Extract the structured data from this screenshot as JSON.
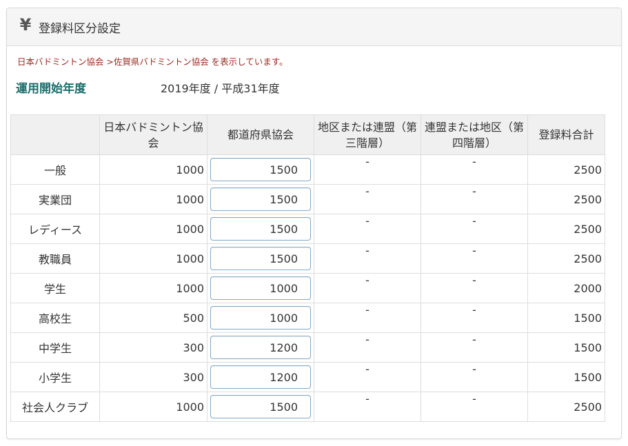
{
  "panel": {
    "icon": "yen-icon",
    "title": "登録料区分設定"
  },
  "notice": "日本バドミントン協会 >佐賀県バドミントン協会 を表示しています。",
  "year": {
    "label": "運用開始年度",
    "value": "2019年度 / 平成31年度"
  },
  "table": {
    "headers": {
      "category": "",
      "national": "日本バドミントン協会",
      "prefecture": "都道府県協会",
      "district": "地区または連盟（第三階層）",
      "league": "連盟または地区（第四階層）",
      "total": "登録料合計"
    },
    "rows": [
      {
        "category": "一般",
        "national": "1000",
        "prefecture": "1500",
        "district": "-",
        "league": "-",
        "total": "2500"
      },
      {
        "category": "実業団",
        "national": "1000",
        "prefecture": "1500",
        "district": "-",
        "league": "-",
        "total": "2500"
      },
      {
        "category": "レディース",
        "national": "1000",
        "prefecture": "1500",
        "district": "-",
        "league": "-",
        "total": "2500"
      },
      {
        "category": "教職員",
        "national": "1000",
        "prefecture": "1500",
        "district": "-",
        "league": "-",
        "total": "2500"
      },
      {
        "category": "学生",
        "national": "1000",
        "prefecture": "1000",
        "district": "-",
        "league": "-",
        "total": "2000"
      },
      {
        "category": "高校生",
        "national": "500",
        "prefecture": "1000",
        "district": "-",
        "league": "-",
        "total": "1500"
      },
      {
        "category": "中学生",
        "national": "300",
        "prefecture": "1200",
        "district": "-",
        "league": "-",
        "total": "1500"
      },
      {
        "category": "小学生",
        "national": "300",
        "prefecture": "1200",
        "district": "-",
        "league": "-",
        "total": "1500"
      },
      {
        "category": "社会人クラブ",
        "national": "1000",
        "prefecture": "1500",
        "district": "-",
        "league": "-",
        "total": "2500"
      }
    ]
  }
}
